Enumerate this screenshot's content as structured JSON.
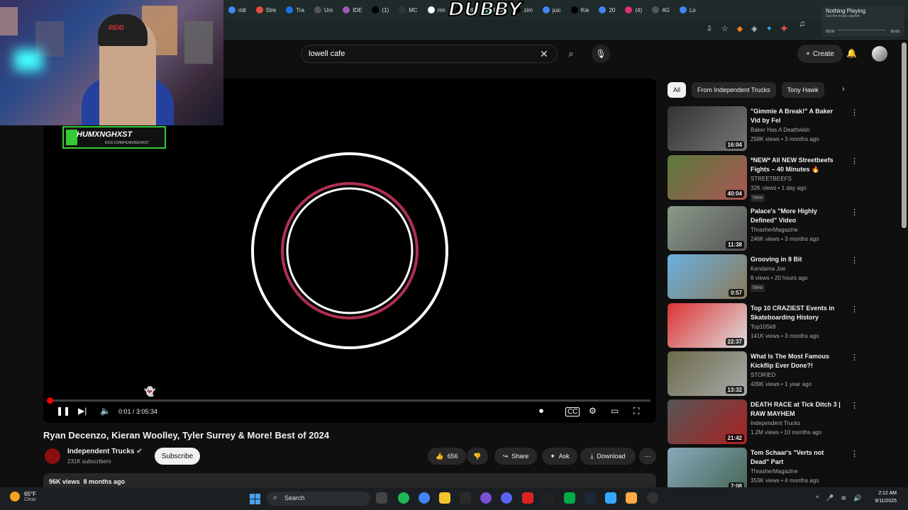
{
  "browser": {
    "tabs": [
      {
        "label": "ridi",
        "color": "#4285f4"
      },
      {
        "label": "Stre",
        "color": "#e74c3c"
      },
      {
        "label": "Tra",
        "color": "#1a73e8"
      },
      {
        "label": "Uni",
        "color": "#555555"
      },
      {
        "label": "IDE",
        "color": "#9b59b6"
      },
      {
        "label": "(1)",
        "color": "#000000"
      },
      {
        "label": "MC",
        "color": "#333333"
      },
      {
        "label": "DUBBY",
        "color": "#888888"
      },
      {
        "label": "rim",
        "color": "#ffffff"
      },
      {
        "label": "(38",
        "color": "#000000"
      },
      {
        "label": "Pick",
        "color": "#2ecc71"
      },
      {
        "label": "zim",
        "color": "#000000"
      },
      {
        "label": "juic",
        "color": "#4285f4"
      },
      {
        "label": "Kie",
        "color": "#000000"
      },
      {
        "label": "20",
        "color": "#4285f4"
      },
      {
        "label": "(4)",
        "color": "#e1306c"
      },
      {
        "label": "4G",
        "color": "#555555"
      },
      {
        "label": "Lo",
        "color": "#4285f4"
      }
    ],
    "overlay_logo": "DUBBY"
  },
  "now_playing": {
    "title": "Nothing Playing",
    "subtitle": "Get the music started",
    "time_start": "00:00",
    "time_end": "00:00"
  },
  "webcam": {
    "hat_text": "REID"
  },
  "search": {
    "query": "lowell cafe"
  },
  "header": {
    "create_label": "Create"
  },
  "stream_overlay": {
    "name": "HUMXNGHXST",
    "url": "KICK.COM/HUMXNGHXST"
  },
  "player": {
    "time": "0:01 / 3:05:34",
    "progress": 0.0001
  },
  "video": {
    "title": "Ryan Decenzo, Kieran Woolley, Tyler Surrey & More! Best of 2024",
    "channel": "Independent Trucks",
    "subscribers": "231K subscribers",
    "subscribe_label": "Subscribe",
    "likes": "656",
    "share_label": "Share",
    "ask_label": "Ask",
    "download_label": "Download",
    "views": "96K views",
    "age": "8 months ago"
  },
  "chips": [
    "All",
    "From Independent Trucks",
    "Tony Hawk"
  ],
  "recommendations": [
    {
      "title": "\"Gimmie A Break!\" A Baker Vid by Fel",
      "channel": "Baker Has A Deathwish",
      "meta": "258K views • 3 months ago",
      "duration": "16:04",
      "new": "",
      "colors": [
        "#333",
        "#777"
      ]
    },
    {
      "title": "*NEW* All NEW Streetbeefs Fights – 40 Minutes 🔥",
      "channel": "STREETBEEFS",
      "meta": "32K views • 1 day ago",
      "duration": "40:04",
      "new": "New",
      "colors": [
        "#5a7a3a",
        "#a55"
      ]
    },
    {
      "title": "Palace's \"More Highly Defined\" Video",
      "channel": "ThrasherMagazine",
      "meta": "246K views • 3 months ago",
      "duration": "11:38",
      "new": "",
      "colors": [
        "#8a9a8a",
        "#555"
      ]
    },
    {
      "title": "Grooving in 8 Bit",
      "channel": "Kendama Joe",
      "meta": "8 views • 20 hours ago",
      "duration": "0:57",
      "new": "New",
      "colors": [
        "#6ab0e0",
        "#8a7a5a"
      ]
    },
    {
      "title": "Top 10 CRAZIEST Events in Skateboarding History",
      "channel": "Top10Sk8",
      "meta": "141K views • 3 months ago",
      "duration": "22:37",
      "new": "",
      "colors": [
        "#d33",
        "#ddd"
      ]
    },
    {
      "title": "What Is The Most Famous Kickflip Ever Done?!",
      "channel": "STORIED",
      "meta": "439K views • 1 year ago",
      "duration": "13:32",
      "new": "",
      "colors": [
        "#6a6a4a",
        "#aaa"
      ]
    },
    {
      "title": "DEATH RACE at Tick Ditch 3 | RAW MAYHEM",
      "channel": "Independent Trucks",
      "meta": "1.2M views • 10 months ago",
      "duration": "21:42",
      "new": "",
      "colors": [
        "#555",
        "#a22"
      ]
    },
    {
      "title": "Tom Schaar's \"Verts not Dead\" Part",
      "channel": "ThrasherMagazine",
      "meta": "353K views • 4 months ago",
      "duration": "7:08",
      "new": "",
      "colors": [
        "#8ab",
        "#465"
      ]
    }
  ],
  "taskbar": {
    "temp": "65°F",
    "condition": "Clear",
    "search_placeholder": "Search",
    "time": "2:12 AM",
    "date": "9/11/2025"
  }
}
